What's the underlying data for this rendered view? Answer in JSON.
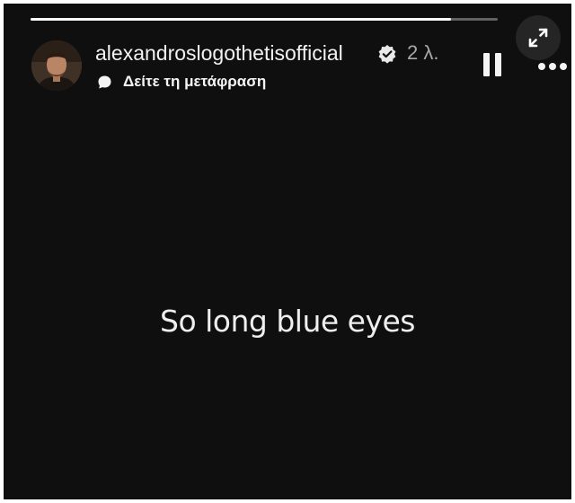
{
  "story": {
    "progress": 0.9,
    "username": "alexandroslogothetisofficial",
    "verified": true,
    "timestamp": "2 λ.",
    "translate_label": "Δείτε τη μετάφραση",
    "text": "So long blue eyes"
  },
  "icons": {
    "verified": "verified-badge-icon",
    "translate": "speech-bubble-icon",
    "pause": "pause-icon",
    "more": "more-horizontal-icon",
    "expand": "expand-icon"
  },
  "colors": {
    "background": "#0f0f0f",
    "text": "#f2f2f2",
    "muted": "#a8a8a8",
    "expand_button_bg": "#252525"
  }
}
